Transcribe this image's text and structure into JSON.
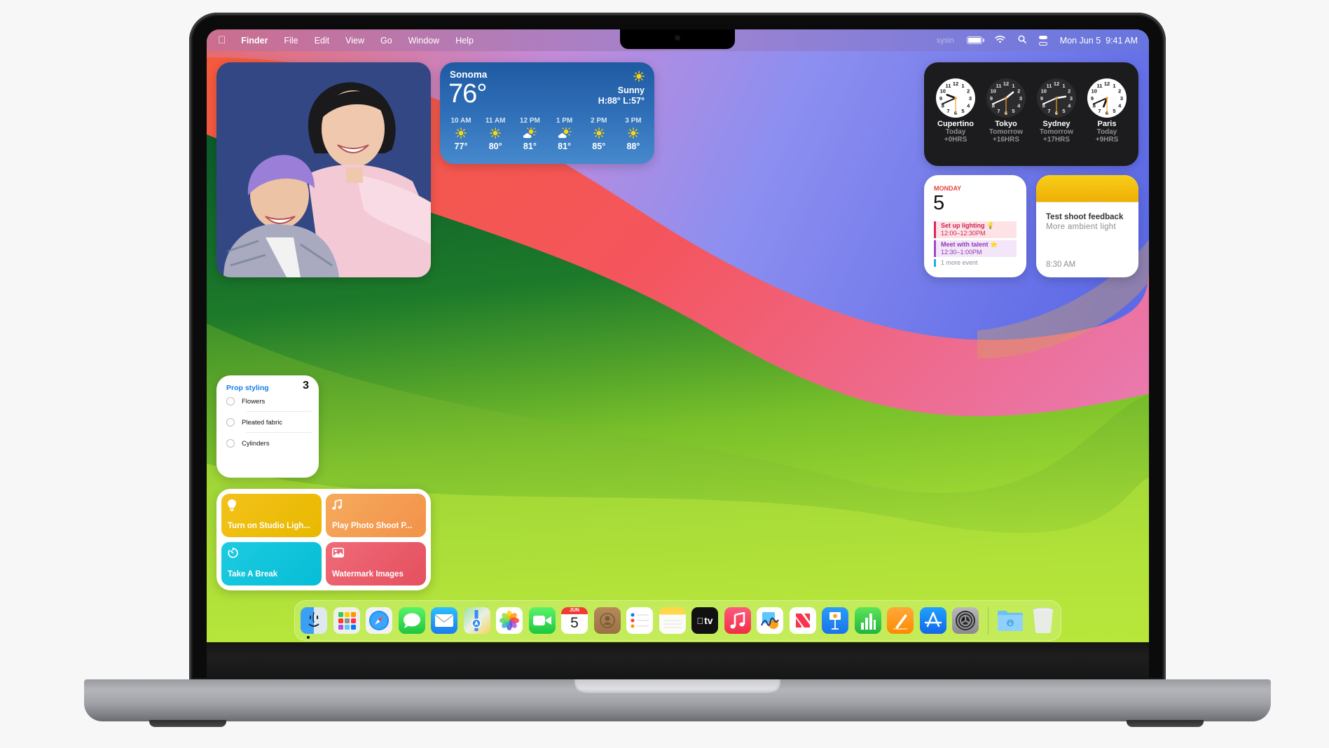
{
  "menubar": {
    "apple_icon": "apple-logo-icon",
    "app_name": "Finder",
    "menus": [
      "File",
      "Edit",
      "View",
      "Go",
      "Window",
      "Help"
    ],
    "status": {
      "input_source": "sysin",
      "icons": [
        "battery-icon",
        "wifi-icon",
        "search-icon",
        "control-center-icon"
      ],
      "date": "Mon Jun 5",
      "time": "9:41 AM"
    }
  },
  "widgets": {
    "photo": {
      "description": "Selfie of woman and child against blue wall"
    },
    "weather": {
      "city": "Sonoma",
      "temperature": "76°",
      "condition": "Sunny",
      "high_low": "H:88° L:57°",
      "hourly": [
        {
          "time": "10 AM",
          "icon": "sun-icon",
          "temp": "77°"
        },
        {
          "time": "11 AM",
          "icon": "sun-icon",
          "temp": "80°"
        },
        {
          "time": "12 PM",
          "icon": "partly-cloudy-icon",
          "temp": "81°"
        },
        {
          "time": "1 PM",
          "icon": "partly-cloudy-icon",
          "temp": "81°"
        },
        {
          "time": "2 PM",
          "icon": "sun-icon",
          "temp": "85°"
        },
        {
          "time": "3 PM",
          "icon": "sun-icon",
          "temp": "88°"
        }
      ]
    },
    "world_clock": [
      {
        "city": "Cupertino",
        "day": "Today",
        "offset": "+0HRS",
        "theme": "light",
        "hour": 9,
        "minute": 41
      },
      {
        "city": "Tokyo",
        "day": "Tomorrow",
        "offset": "+16HRS",
        "theme": "dark",
        "hour": 1,
        "minute": 41
      },
      {
        "city": "Sydney",
        "day": "Tomorrow",
        "offset": "+17HRS",
        "theme": "dark",
        "hour": 2,
        "minute": 41
      },
      {
        "city": "Paris",
        "day": "Today",
        "offset": "+9HRS",
        "theme": "light",
        "hour": 6,
        "minute": 41
      }
    ],
    "calendar": {
      "weekday": "MONDAY",
      "day": "5",
      "events": [
        {
          "title": "Set up lighting 💡",
          "time": "12:00–12:30PM",
          "color": "#e0245e"
        },
        {
          "title": "Meet with talent ⭐",
          "time": "12:30–1:00PM",
          "color": "#a347c6"
        }
      ],
      "more": "1 more event"
    },
    "notes": {
      "title": "Test shoot feedback",
      "body": "More ambient light",
      "time": "8:30 AM"
    },
    "reminders": {
      "list_name": "Prop styling",
      "count": "3",
      "items": [
        "Flowers",
        "Pleated fabric",
        "Cylinders"
      ]
    },
    "shortcuts": [
      {
        "label": "Turn on Studio Ligh...",
        "icon": "lightbulb-icon"
      },
      {
        "label": "Play Photo Shoot P...",
        "icon": "music-note-icon"
      },
      {
        "label": "Take A Break",
        "icon": "timer-icon"
      },
      {
        "label": "Watermark Images",
        "icon": "photo-icon"
      }
    ]
  },
  "dock": {
    "apps": [
      {
        "name": "Finder",
        "running": true
      },
      {
        "name": "Launchpad"
      },
      {
        "name": "Safari"
      },
      {
        "name": "Messages"
      },
      {
        "name": "Mail"
      },
      {
        "name": "Maps"
      },
      {
        "name": "Photos"
      },
      {
        "name": "FaceTime"
      },
      {
        "name": "Calendar",
        "month": "JUN",
        "day": "5"
      },
      {
        "name": "Contacts"
      },
      {
        "name": "Reminders"
      },
      {
        "name": "Notes"
      },
      {
        "name": "TV",
        "label": "tv"
      },
      {
        "name": "Music"
      },
      {
        "name": "Freeform"
      },
      {
        "name": "News"
      },
      {
        "name": "Keynote"
      },
      {
        "name": "Numbers"
      },
      {
        "name": "Pages"
      },
      {
        "name": "App Store"
      },
      {
        "name": "System Settings"
      }
    ],
    "others": [
      {
        "name": "Downloads"
      },
      {
        "name": "Trash"
      }
    ]
  }
}
